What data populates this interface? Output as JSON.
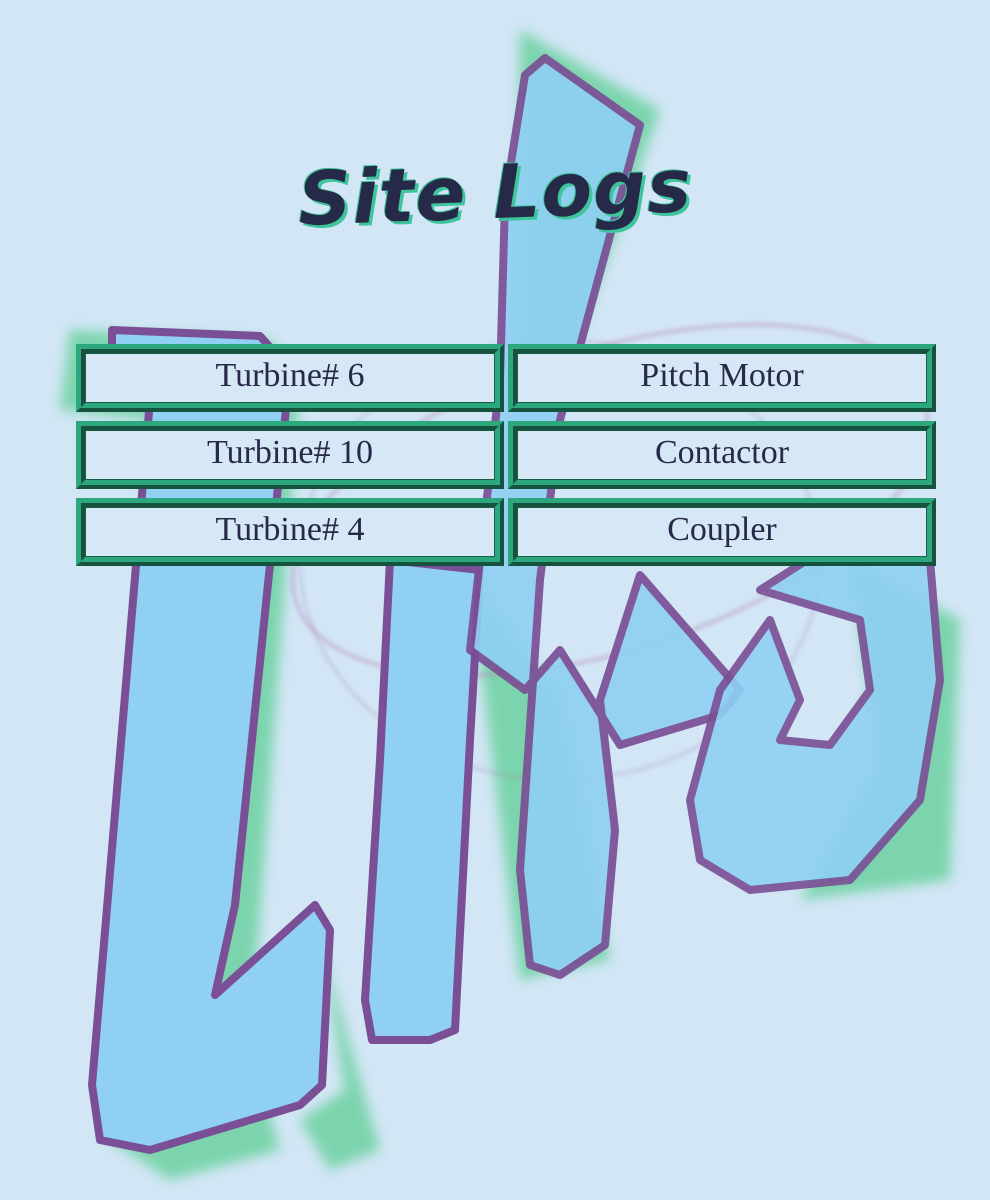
{
  "header": {
    "title": "Site Logs"
  },
  "logs": {
    "items": [
      {
        "label": "Turbine# 6"
      },
      {
        "label": "Pitch Motor"
      },
      {
        "label": "Turbine# 10"
      },
      {
        "label": "Contactor"
      },
      {
        "label": "Turbine# 4"
      },
      {
        "label": "Coupler"
      }
    ]
  },
  "colors": {
    "background": "#d2e6f5",
    "button_border": "#2da77e",
    "text": "#262a48",
    "art_fill": "#8fd0f3",
    "art_outline": "#7a4f95",
    "art_shadow": "#4fc78f"
  }
}
